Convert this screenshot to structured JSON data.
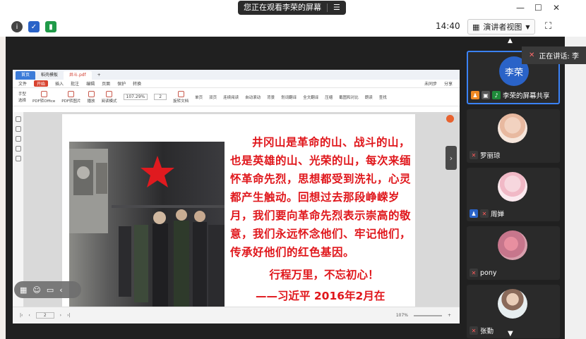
{
  "meeting": {
    "share_notice": "您正在观看李荣的屏幕",
    "clock": "14:40",
    "view_mode": "演讲者视图",
    "speaking_label": "正在讲话: 李",
    "participants": [
      {
        "name": "李荣的屏幕共享",
        "avatar_text": "李荣"
      },
      {
        "name": "罗丽琼"
      },
      {
        "name": "周婵"
      },
      {
        "name": "pony"
      },
      {
        "name": "张勤"
      }
    ]
  },
  "pdf": {
    "tabs": [
      "首页",
      "稻壳模板",
      "井斗.pdf"
    ],
    "menu": [
      "文件",
      "开始",
      "插入",
      "批注",
      "编辑",
      "页面",
      "保护",
      "转换"
    ],
    "menu_right": [
      "未同步",
      "分享"
    ],
    "tools": [
      "手型",
      "选择",
      "PDF转Office",
      "PDF转图片",
      "播放",
      "阅读模式",
      "旋转文档",
      "单页",
      "双页",
      "连续阅读",
      "自动滚动",
      "背景",
      "划词翻译",
      "全文翻译",
      "压缩",
      "截图和对比",
      "朗读",
      "查找"
    ],
    "zoom": "107.29%",
    "page_indicator": "2",
    "status_zoom": "107%",
    "status_page": "2"
  },
  "poem": {
    "text": "井冈山是革命的山、战斗的山，也是英雄的山、光荣的山，每次来缅怀革命先烈，思想都受到洗礼，心灵都产生触动。回想过去那段峥嵘岁月，我们要向革命先烈表示崇高的敬意，我们永远怀念他们、牢记他们，传承好他们的红色基因。",
    "slogan": "行程万里，不忘初心！",
    "author": "——习近平 2016年2月在"
  },
  "colors": {
    "poem_red": "#e0161b",
    "accent_blue": "#3b82f6",
    "pdf_red": "#d8432f"
  }
}
